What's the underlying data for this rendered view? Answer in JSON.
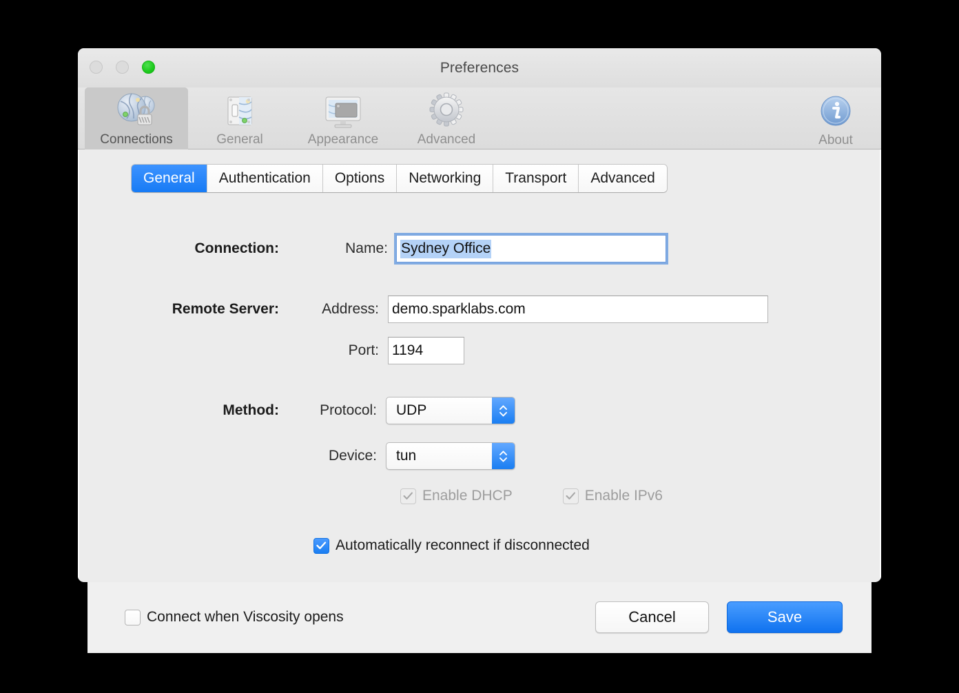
{
  "window": {
    "title": "Preferences",
    "traffic_lights": [
      {
        "name": "close",
        "state": "inactive"
      },
      {
        "name": "minimize",
        "state": "inactive"
      },
      {
        "name": "zoom",
        "state": "active",
        "color": "#1ecb1e"
      }
    ]
  },
  "toolbar": {
    "items": [
      {
        "label": "Connections",
        "icon": "globes-lock-icon",
        "selected": true
      },
      {
        "label": "General",
        "icon": "light-switch-icon",
        "selected": false
      },
      {
        "label": "Appearance",
        "icon": "display-window-icon",
        "selected": false
      },
      {
        "label": "Advanced",
        "icon": "gear-icon",
        "selected": false
      }
    ],
    "about": {
      "label": "About",
      "icon": "info-circle-icon"
    }
  },
  "tabs": [
    {
      "label": "General",
      "active": true
    },
    {
      "label": "Authentication",
      "active": false
    },
    {
      "label": "Options",
      "active": false
    },
    {
      "label": "Networking",
      "active": false
    },
    {
      "label": "Transport",
      "active": false
    },
    {
      "label": "Advanced",
      "active": false
    }
  ],
  "form": {
    "connection": {
      "group_label": "Connection:",
      "name_label": "Name:",
      "name_value": "Sydney Office",
      "name_selected": true,
      "name_focused": true
    },
    "remote_server": {
      "group_label": "Remote Server:",
      "address_label": "Address:",
      "address_value": "demo.sparklabs.com",
      "port_label": "Port:",
      "port_value": "1194"
    },
    "method": {
      "group_label": "Method:",
      "protocol_label": "Protocol:",
      "protocol_value": "UDP",
      "device_label": "Device:",
      "device_value": "tun"
    },
    "checkboxes": [
      {
        "label": "Enable DHCP",
        "checked": true,
        "enabled": false
      },
      {
        "label": "Enable IPv6",
        "checked": true,
        "enabled": false
      }
    ],
    "reconnect": {
      "label": "Automatically reconnect if disconnected",
      "checked": true,
      "enabled": true
    }
  },
  "bottom": {
    "connect_on_open": {
      "label": "Connect when Viscosity opens",
      "checked": false
    },
    "cancel_label": "Cancel",
    "save_label": "Save"
  },
  "colors": {
    "accent_blue": "#177bf5",
    "selection_blue": "#b4d2f7",
    "window_bg": "#ececec"
  }
}
